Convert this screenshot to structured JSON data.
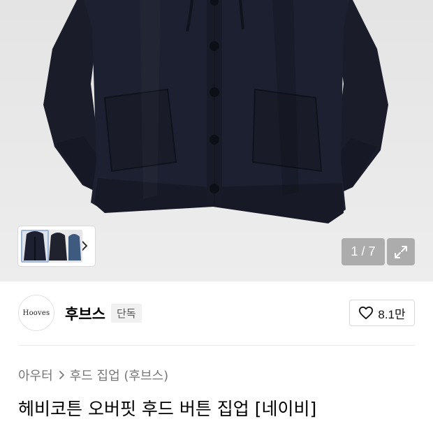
{
  "gallery": {
    "counter": "1 / 7",
    "thumbnail_count": 3
  },
  "icons": {
    "thumbnail_next": "chevron-right-icon",
    "expand": "expand-icon",
    "like": "heart-icon"
  },
  "brand": {
    "logo_text": "Hooves",
    "name": "후브스",
    "badge": "단독"
  },
  "like": {
    "count": "8.1만"
  },
  "breadcrumb": {
    "category": "아우터",
    "subcategory": "후드 집업 (후브스)"
  },
  "product": {
    "title": "헤비코튼 오버핏 후드 버튼 집업 [네이비]"
  },
  "colors": {
    "garment": "#1b1f2b",
    "background": "#e8e8e8"
  }
}
